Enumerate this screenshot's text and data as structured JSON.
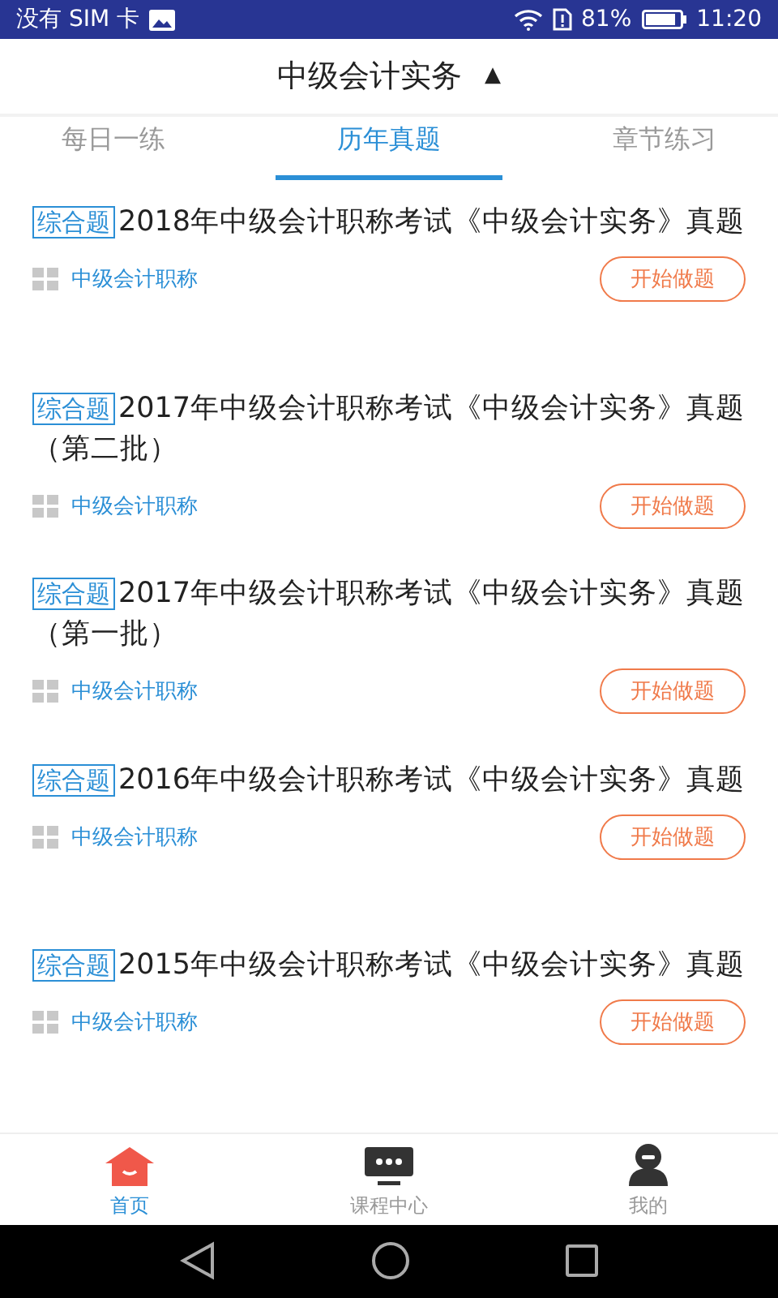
{
  "status_bar": {
    "carrier": "没有 SIM 卡",
    "battery": "81%",
    "time": "11:20"
  },
  "header": {
    "title": "中级会计实务",
    "arrow": "▲"
  },
  "tabs": [
    {
      "label": "每日一练",
      "selected": false
    },
    {
      "label": "历年真题",
      "selected": true
    },
    {
      "label": "章节练习",
      "selected": false
    }
  ],
  "papers": [
    {
      "tag": "综合题",
      "title": "2018年中级会计职称考试《中级会计实务》真题",
      "category": "中级会计职称",
      "action": "开始做题"
    },
    {
      "tag": "综合题",
      "title": "2017年中级会计职称考试《中级会计实务》真题（第二批）",
      "category": "中级会计职称",
      "action": "开始做题"
    },
    {
      "tag": "综合题",
      "title": "2017年中级会计职称考试《中级会计实务》真题（第一批）",
      "category": "中级会计职称",
      "action": "开始做题"
    },
    {
      "tag": "综合题",
      "title": "2016年中级会计职称考试《中级会计实务》真题",
      "category": "中级会计职称",
      "action": "开始做题"
    },
    {
      "tag": "综合题",
      "title": "2015年中级会计职称考试《中级会计实务》真题",
      "category": "中级会计职称",
      "action": "开始做题"
    }
  ],
  "bottom_nav": [
    {
      "kind": "home",
      "label": "首页",
      "selected": true
    },
    {
      "kind": "courses",
      "label": "课程中心",
      "selected": false
    },
    {
      "kind": "profile",
      "label": "我的",
      "selected": false
    }
  ]
}
